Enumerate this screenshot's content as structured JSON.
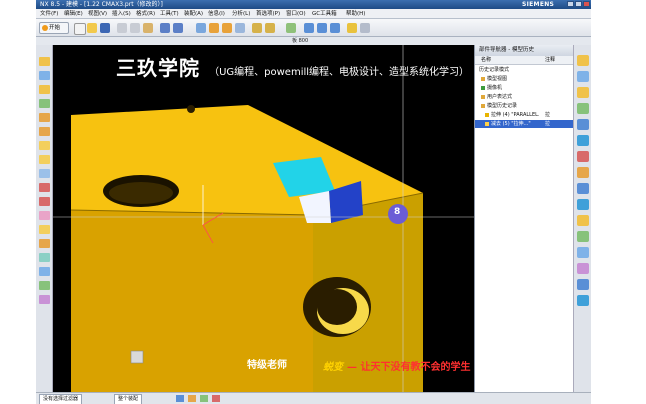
{
  "window": {
    "title": "NX 8.5 - 建模 - [1.22 CMAX3.prt（修改的）]",
    "brand": "SIEMENS"
  },
  "menu": {
    "items": [
      "文件(F)",
      "编辑(E)",
      "视图(V)",
      "插入(S)",
      "格式(R)",
      "工具(T)",
      "装配(A)",
      "信息(I)",
      "分析(L)",
      "首选项(P)",
      "窗口(O)",
      "GC工具箱",
      "帮助(H)"
    ]
  },
  "toolbar": {
    "start_label": "开始"
  },
  "toolbar2": {
    "label": "板 800"
  },
  "viewport": {
    "banner_title": "三玖学院",
    "banner_subtitle": "（UG编程、powe​mill编程、电极设计、造型系统化学习）",
    "teacher_label": "特级老师",
    "signature": "蜕变",
    "slogan": "— 让天下没有教不会的学生",
    "cursor_badge": "8"
  },
  "navigator": {
    "title": "部件导航器 - 模型历史",
    "columns": [
      "名称",
      "注释"
    ],
    "rows": [
      {
        "name": "历史记录模式",
        "note": ""
      },
      {
        "name": "模型视图",
        "note": ""
      },
      {
        "name": "摄像机",
        "note": ""
      },
      {
        "name": "用户表达式",
        "note": ""
      },
      {
        "name": "模型历史记录",
        "note": ""
      },
      {
        "name": "拉伸 (4) \"PARALLEL...\"",
        "note": "拉"
      },
      {
        "name": "减去 (5) \"拉伸...\"",
        "note": "拉"
      }
    ]
  },
  "statusbar": {
    "filter_label": "没有选择过滤器",
    "assembly_label": "整个装配"
  },
  "colors": {
    "part_yellow": "#e8b400",
    "accent_cyan": "#22d3e8",
    "accent_blue": "#2342c8",
    "banner_red": "#ff3030"
  }
}
